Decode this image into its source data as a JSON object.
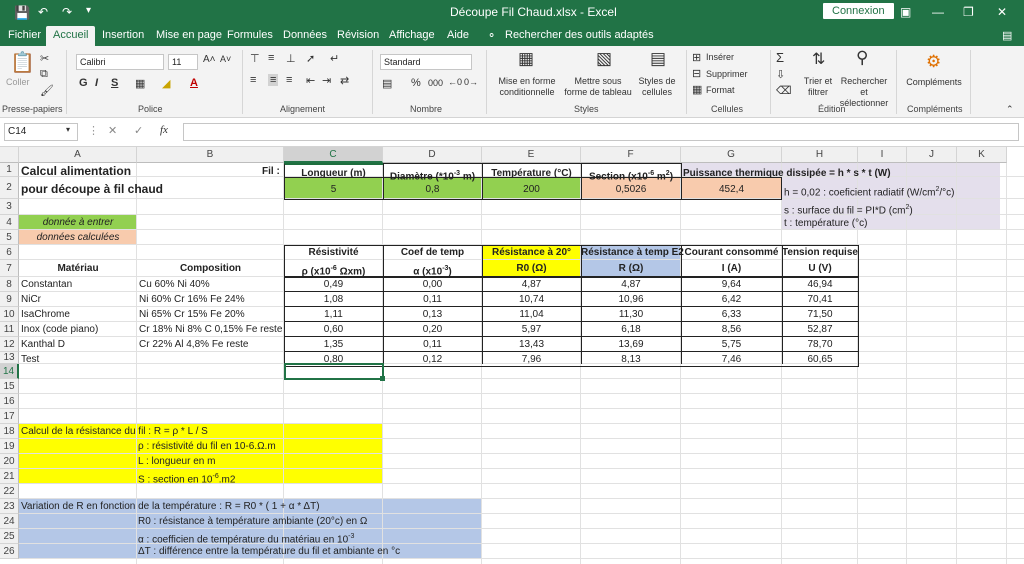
{
  "window": {
    "title": "Découpe Fil Chaud.xlsx  -  Excel",
    "connect": "Connexion"
  },
  "tabs": [
    "Fichier",
    "Accueil",
    "Insertion",
    "Mise en page",
    "Formules",
    "Données",
    "Révision",
    "Affichage",
    "Aide"
  ],
  "search_tools": "Rechercher des outils adaptés",
  "ribbon": {
    "paste": "Coller",
    "clipboard": "Presse-papiers",
    "font_name": "Calibri",
    "font_size": "11",
    "police": "Police",
    "alignment": "Alignement",
    "number_format": "Standard",
    "nombre": "Nombre",
    "cond_fmt": "Mise en forme conditionnelle",
    "table_fmt": "Mettre sous forme de tableau",
    "cell_styles": "Styles de cellules",
    "styles": "Styles",
    "insert": "Insérer",
    "delete": "Supprimer",
    "format": "Format",
    "cellules": "Cellules",
    "sort": "Trier et filtrer",
    "find": "Rechercher et sélectionner",
    "edition": "Édition",
    "addins": "Compléments",
    "addins_grp": "Compléments",
    "bold": "G",
    "italic": "I",
    "underline": "S",
    "font_color": "A",
    "percent": "%",
    "thousands": "000"
  },
  "name_box": "C14",
  "formula_content": "",
  "fx": "fx",
  "columns": [
    "A",
    "B",
    "C",
    "D",
    "E",
    "F",
    "G",
    "H",
    "I",
    "J",
    "K"
  ],
  "rows": [
    "1",
    "2",
    "3",
    "4",
    "5",
    "6",
    "7",
    "8",
    "9",
    "10",
    "11",
    "12",
    "13",
    "14",
    "15",
    "16",
    "17",
    "18",
    "19",
    "20",
    "21",
    "22",
    "23",
    "24",
    "25",
    "26"
  ],
  "sheet": {
    "title1": "Calcul alimentation",
    "title2": "pour découpe à fil chaud",
    "fil": "Fil :",
    "in_hdr": [
      "Longueur (m)",
      "Diamètre (*10",
      "-3",
      " m)",
      "Température (°C)",
      "Section (x10",
      "-6",
      " m",
      "2",
      ")"
    ],
    "in_vals": [
      "5",
      "0,8",
      "200",
      "0,5026",
      "452,4"
    ],
    "puissance": "Puissance thermique dissipée = h * s * t (W)",
    "h_note": "h = 0,02 : coeficient radiatif (W/cm",
    "h_sup": "2",
    "h_note2": "/°c)",
    "s_note": "s : surface du fil = PI*D (cm",
    "s_sup": "2",
    "s_note2": ")",
    "t_note": "t : température (°c)",
    "legend_in": "donnée à entrer",
    "legend_calc": "données calculées",
    "hdr6": [
      "Résistivité",
      "Coef de temp",
      "Résistance à 20°",
      "Résistance à temp E2",
      "Courant consommé",
      "Tension requise"
    ],
    "hdr7": [
      "Matériau",
      "Composition",
      "ρ (x10",
      "-6",
      " Ωxm)",
      "α (x10",
      "-3",
      ")",
      "R0 (Ω)",
      "R (Ω)",
      "I (A)",
      "U (V)"
    ],
    "table": [
      [
        "Constantan",
        "Cu 60% Ni 40%",
        "0,49",
        "0,00",
        "4,87",
        "4,87",
        "9,64",
        "46,94"
      ],
      [
        "NiCr",
        "Ni 60% Cr 16% Fe 24%",
        "1,08",
        "0,11",
        "10,74",
        "10,96",
        "6,42",
        "70,41"
      ],
      [
        "IsaChrome",
        "Ni 65% Cr 15% Fe 20%",
        "1,11",
        "0,13",
        "11,04",
        "11,30",
        "6,33",
        "71,50"
      ],
      [
        "Inox (code piano)",
        "Cr 18% Ni 8% C 0,15% Fe reste",
        "0,60",
        "0,20",
        "5,97",
        "6,18",
        "8,56",
        "52,87"
      ],
      [
        "Kanthal D",
        "Cr 22% Al 4,8% Fe reste",
        "1,35",
        "0,11",
        "13,43",
        "13,69",
        "5,75",
        "78,70"
      ],
      [
        "Test",
        "",
        "0,80",
        "0,12",
        "7,96",
        "8,13",
        "7,46",
        "60,65"
      ]
    ],
    "calc_r": [
      "Calcul de la résistance du fil :   R = ρ * L / S",
      "ρ : résistivité du fil en 10-6.Ω.m",
      "L : longueur en m",
      "S : section en 10",
      "-6",
      ".m2"
    ],
    "var_r": [
      "Variation de R en fonction de la température :   R = R0 * ( 1 + α * ΔT)",
      "R0 : résistance à température ambiante (20°c) en Ω",
      "α : coefficien de température du matériau en 10",
      "-3",
      "ΔT : différence entre la température du fil et ambiante en °c"
    ]
  },
  "colors": {
    "green": "#217346",
    "input": "#92d050",
    "calc": "#f8cbad",
    "yellow": "#ffff00",
    "blue": "#b4c7e7",
    "lavender": "#e4dfec"
  }
}
